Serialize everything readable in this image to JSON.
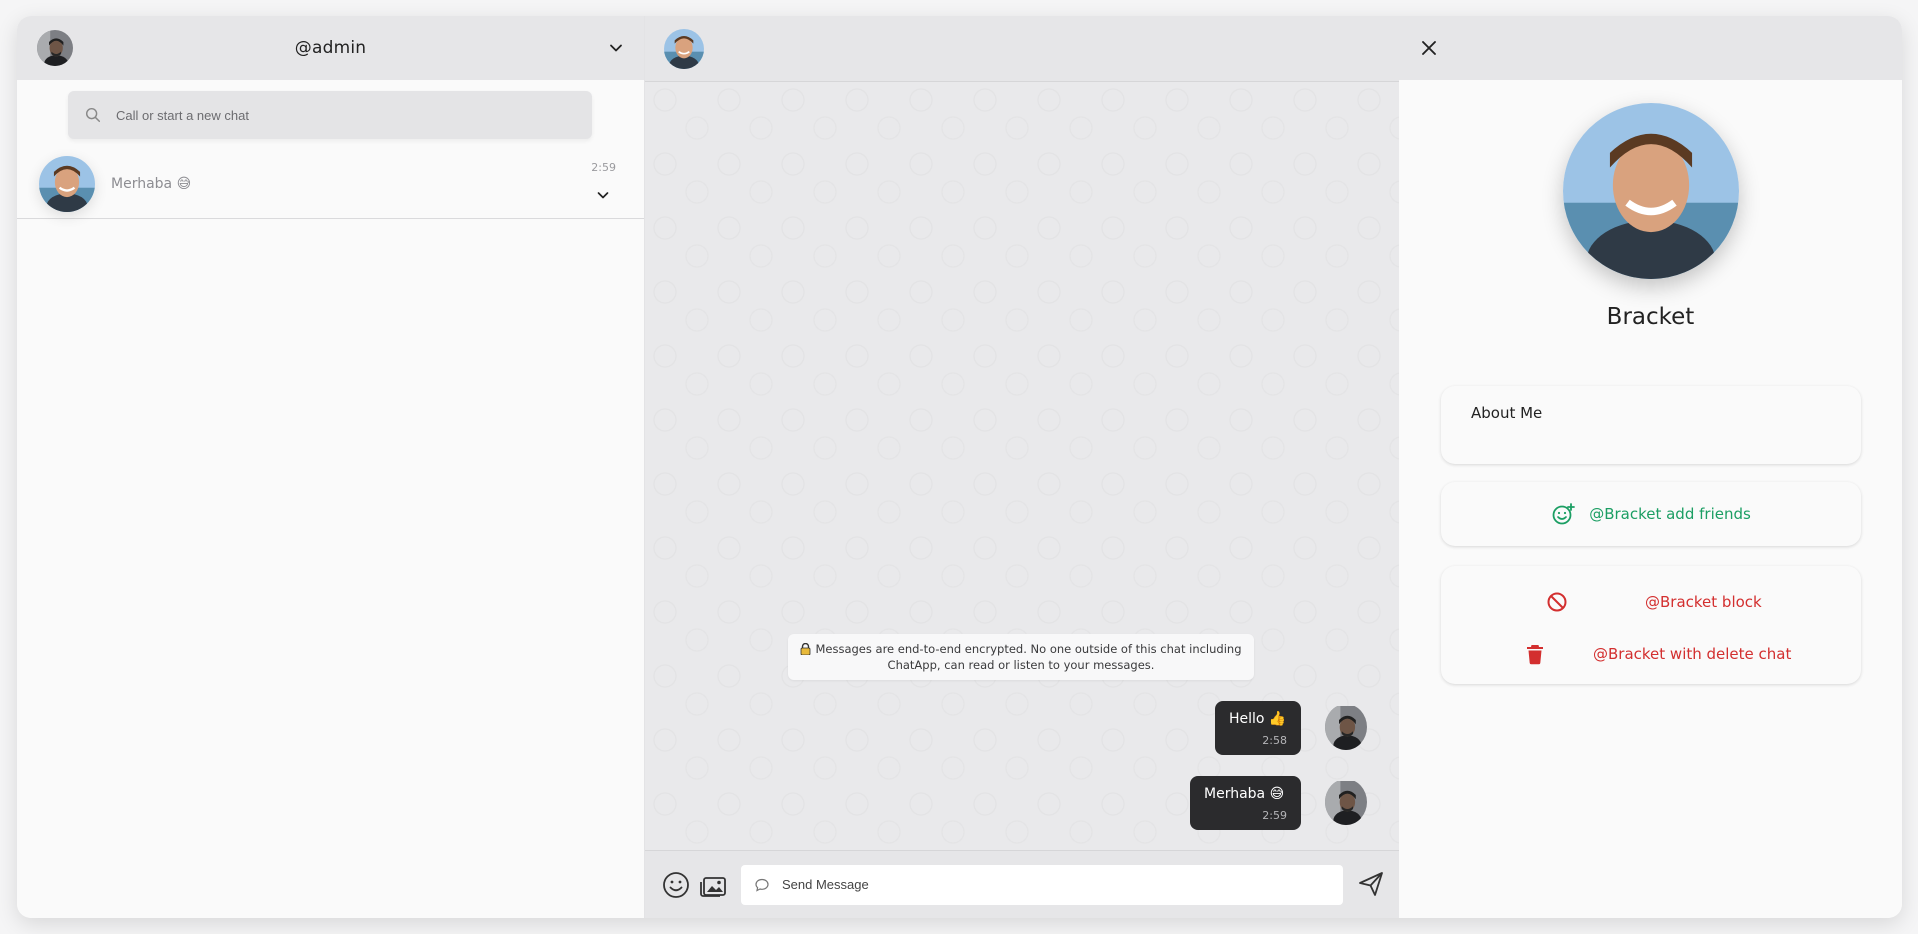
{
  "sidebar": {
    "username": "@admin",
    "search": {
      "placeholder": "Call or start a new chat"
    },
    "chats": [
      {
        "last_message": "Merhaba 😅",
        "time": "2:59"
      }
    ]
  },
  "chat": {
    "encryption_notice_line1": "Messages are end-to-end encrypted. No one outside of this chat including",
    "encryption_notice_line2": "ChatApp, can read or listen to your messages.",
    "messages": [
      {
        "text": "Hello 👍",
        "time": "2:58"
      },
      {
        "text": "Merhaba 😅",
        "time": "2:59"
      }
    ],
    "composer": {
      "placeholder": "Send Message"
    }
  },
  "profile": {
    "name": "Bracket",
    "about_title": "About Me",
    "add_friends_label": "@Bracket add friends",
    "block_label": "@Bracket block",
    "delete_chat_label": "@Bracket with delete chat"
  },
  "colors": {
    "add_accent": "#1b9e63",
    "danger": "#d32f2f",
    "bubble": "#2b2b2d"
  }
}
